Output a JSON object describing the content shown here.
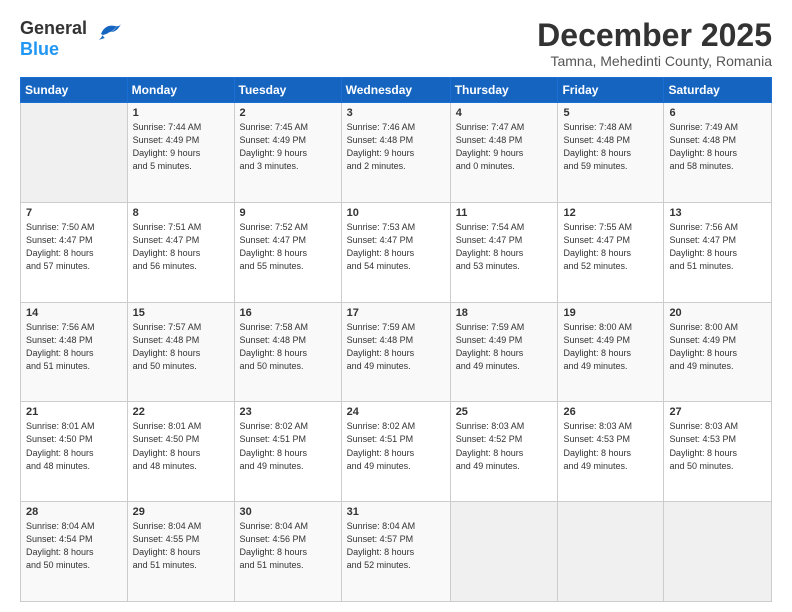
{
  "header": {
    "logo_general": "General",
    "logo_blue": "Blue",
    "month": "December 2025",
    "location": "Tamna, Mehedinti County, Romania"
  },
  "days_of_week": [
    "Sunday",
    "Monday",
    "Tuesday",
    "Wednesday",
    "Thursday",
    "Friday",
    "Saturday"
  ],
  "weeks": [
    [
      {
        "day": "",
        "info": ""
      },
      {
        "day": "1",
        "info": "Sunrise: 7:44 AM\nSunset: 4:49 PM\nDaylight: 9 hours\nand 5 minutes."
      },
      {
        "day": "2",
        "info": "Sunrise: 7:45 AM\nSunset: 4:49 PM\nDaylight: 9 hours\nand 3 minutes."
      },
      {
        "day": "3",
        "info": "Sunrise: 7:46 AM\nSunset: 4:48 PM\nDaylight: 9 hours\nand 2 minutes."
      },
      {
        "day": "4",
        "info": "Sunrise: 7:47 AM\nSunset: 4:48 PM\nDaylight: 9 hours\nand 0 minutes."
      },
      {
        "day": "5",
        "info": "Sunrise: 7:48 AM\nSunset: 4:48 PM\nDaylight: 8 hours\nand 59 minutes."
      },
      {
        "day": "6",
        "info": "Sunrise: 7:49 AM\nSunset: 4:48 PM\nDaylight: 8 hours\nand 58 minutes."
      }
    ],
    [
      {
        "day": "7",
        "info": "Sunrise: 7:50 AM\nSunset: 4:47 PM\nDaylight: 8 hours\nand 57 minutes."
      },
      {
        "day": "8",
        "info": "Sunrise: 7:51 AM\nSunset: 4:47 PM\nDaylight: 8 hours\nand 56 minutes."
      },
      {
        "day": "9",
        "info": "Sunrise: 7:52 AM\nSunset: 4:47 PM\nDaylight: 8 hours\nand 55 minutes."
      },
      {
        "day": "10",
        "info": "Sunrise: 7:53 AM\nSunset: 4:47 PM\nDaylight: 8 hours\nand 54 minutes."
      },
      {
        "day": "11",
        "info": "Sunrise: 7:54 AM\nSunset: 4:47 PM\nDaylight: 8 hours\nand 53 minutes."
      },
      {
        "day": "12",
        "info": "Sunrise: 7:55 AM\nSunset: 4:47 PM\nDaylight: 8 hours\nand 52 minutes."
      },
      {
        "day": "13",
        "info": "Sunrise: 7:56 AM\nSunset: 4:47 PM\nDaylight: 8 hours\nand 51 minutes."
      }
    ],
    [
      {
        "day": "14",
        "info": "Sunrise: 7:56 AM\nSunset: 4:48 PM\nDaylight: 8 hours\nand 51 minutes."
      },
      {
        "day": "15",
        "info": "Sunrise: 7:57 AM\nSunset: 4:48 PM\nDaylight: 8 hours\nand 50 minutes."
      },
      {
        "day": "16",
        "info": "Sunrise: 7:58 AM\nSunset: 4:48 PM\nDaylight: 8 hours\nand 50 minutes."
      },
      {
        "day": "17",
        "info": "Sunrise: 7:59 AM\nSunset: 4:48 PM\nDaylight: 8 hours\nand 49 minutes."
      },
      {
        "day": "18",
        "info": "Sunrise: 7:59 AM\nSunset: 4:49 PM\nDaylight: 8 hours\nand 49 minutes."
      },
      {
        "day": "19",
        "info": "Sunrise: 8:00 AM\nSunset: 4:49 PM\nDaylight: 8 hours\nand 49 minutes."
      },
      {
        "day": "20",
        "info": "Sunrise: 8:00 AM\nSunset: 4:49 PM\nDaylight: 8 hours\nand 49 minutes."
      }
    ],
    [
      {
        "day": "21",
        "info": "Sunrise: 8:01 AM\nSunset: 4:50 PM\nDaylight: 8 hours\nand 48 minutes."
      },
      {
        "day": "22",
        "info": "Sunrise: 8:01 AM\nSunset: 4:50 PM\nDaylight: 8 hours\nand 48 minutes."
      },
      {
        "day": "23",
        "info": "Sunrise: 8:02 AM\nSunset: 4:51 PM\nDaylight: 8 hours\nand 49 minutes."
      },
      {
        "day": "24",
        "info": "Sunrise: 8:02 AM\nSunset: 4:51 PM\nDaylight: 8 hours\nand 49 minutes."
      },
      {
        "day": "25",
        "info": "Sunrise: 8:03 AM\nSunset: 4:52 PM\nDaylight: 8 hours\nand 49 minutes."
      },
      {
        "day": "26",
        "info": "Sunrise: 8:03 AM\nSunset: 4:53 PM\nDaylight: 8 hours\nand 49 minutes."
      },
      {
        "day": "27",
        "info": "Sunrise: 8:03 AM\nSunset: 4:53 PM\nDaylight: 8 hours\nand 50 minutes."
      }
    ],
    [
      {
        "day": "28",
        "info": "Sunrise: 8:04 AM\nSunset: 4:54 PM\nDaylight: 8 hours\nand 50 minutes."
      },
      {
        "day": "29",
        "info": "Sunrise: 8:04 AM\nSunset: 4:55 PM\nDaylight: 8 hours\nand 51 minutes."
      },
      {
        "day": "30",
        "info": "Sunrise: 8:04 AM\nSunset: 4:56 PM\nDaylight: 8 hours\nand 51 minutes."
      },
      {
        "day": "31",
        "info": "Sunrise: 8:04 AM\nSunset: 4:57 PM\nDaylight: 8 hours\nand 52 minutes."
      },
      {
        "day": "",
        "info": ""
      },
      {
        "day": "",
        "info": ""
      },
      {
        "day": "",
        "info": ""
      }
    ]
  ]
}
